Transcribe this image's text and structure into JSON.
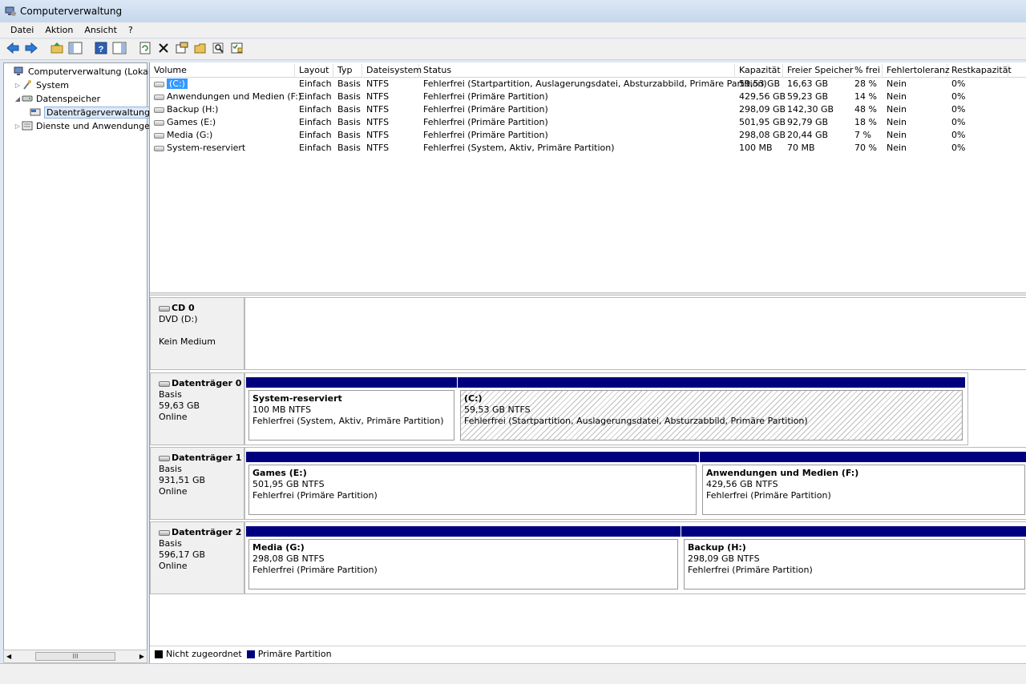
{
  "window": {
    "title": "Computerverwaltung"
  },
  "menu": [
    "Datei",
    "Aktion",
    "Ansicht",
    "?"
  ],
  "toolbar": [
    "back-icon",
    "forward-icon",
    "sep",
    "up-folder-icon",
    "show-hide-tree-icon",
    "sep",
    "help-icon",
    "show-action-pane-icon",
    "sep",
    "refresh-icon",
    "delete-icon",
    "properties-icon",
    "open-icon",
    "search-icon",
    "checklist-icon"
  ],
  "tree": [
    {
      "label": "Computerverwaltung (Lokal)",
      "level": 0,
      "arrow": "",
      "icon": "computer-icon",
      "selected": false
    },
    {
      "label": "System",
      "level": 1,
      "arrow": "▷",
      "icon": "tools-icon",
      "selected": false
    },
    {
      "label": "Datenspeicher",
      "level": 1,
      "arrow": "◢",
      "icon": "storage-icon",
      "selected": false
    },
    {
      "label": "Datenträgerverwaltung",
      "level": 2,
      "arrow": "",
      "icon": "disk-management-icon",
      "selected": true
    },
    {
      "label": "Dienste und Anwendungen",
      "level": 1,
      "arrow": "▷",
      "icon": "services-icon",
      "selected": false
    }
  ],
  "scroll_thumb": "III",
  "columns": [
    "Volume",
    "Layout",
    "Typ",
    "Dateisystem",
    "Status",
    "Kapazität",
    "Freier Speicher",
    "% frei",
    "Fehlertoleranz",
    "Restkapazität"
  ],
  "volumes": [
    {
      "cells": [
        "(C:)",
        "Einfach",
        "Basis",
        "NTFS",
        "Fehlerfrei (Startpartition, Auslagerungsdatei, Absturzabbild, Primäre Partition)",
        "59,53 GB",
        "16,63 GB",
        "28 %",
        "Nein",
        "0%"
      ],
      "selected": true
    },
    {
      "cells": [
        "Anwendungen und Medien (F:)",
        "Einfach",
        "Basis",
        "NTFS",
        "Fehlerfrei (Primäre Partition)",
        "429,56 GB",
        "59,23 GB",
        "14 %",
        "Nein",
        "0%"
      ]
    },
    {
      "cells": [
        "Backup (H:)",
        "Einfach",
        "Basis",
        "NTFS",
        "Fehlerfrei (Primäre Partition)",
        "298,09 GB",
        "142,30 GB",
        "48 %",
        "Nein",
        "0%"
      ]
    },
    {
      "cells": [
        "Games (E:)",
        "Einfach",
        "Basis",
        "NTFS",
        "Fehlerfrei (Primäre Partition)",
        "501,95 GB",
        "92,79 GB",
        "18 %",
        "Nein",
        "0%"
      ]
    },
    {
      "cells": [
        "Media (G:)",
        "Einfach",
        "Basis",
        "NTFS",
        "Fehlerfrei (Primäre Partition)",
        "298,08 GB",
        "20,44 GB",
        "7 %",
        "Nein",
        "0%"
      ]
    },
    {
      "cells": [
        "System-reserviert",
        "Einfach",
        "Basis",
        "NTFS",
        "Fehlerfrei (System, Aktiv, Primäre Partition)",
        "100 MB",
        "70 MB",
        "70 %",
        "Nein",
        "0%"
      ]
    }
  ],
  "disks": [
    {
      "name": "CD 0",
      "lines": [
        "DVD (D:)",
        "",
        "Kein Medium"
      ],
      "partitions": []
    },
    {
      "name": "Datenträger 0",
      "lines": [
        "Basis",
        "59,63 GB",
        "Online"
      ],
      "partitions": [
        {
          "name": "System-reserviert",
          "size": "100 MB NTFS",
          "status": "Fehlerfrei (System, Aktiv, Primäre Partition)",
          "hatched": false
        },
        {
          "name": "(C:)",
          "size": "59,53 GB NTFS",
          "status": "Fehlerfrei (Startpartition, Auslagerungsdatei, Absturzabbild, Primäre Partition)",
          "hatched": true
        }
      ]
    },
    {
      "name": "Datenträger 1",
      "lines": [
        "Basis",
        "931,51 GB",
        "Online"
      ],
      "partitions": [
        {
          "name": "Games  (E:)",
          "size": "501,95 GB NTFS",
          "status": "Fehlerfrei (Primäre Partition)",
          "hatched": false
        },
        {
          "name": "Anwendungen und Medien  (F:)",
          "size": "429,56 GB NTFS",
          "status": "Fehlerfrei (Primäre Partition)",
          "hatched": false
        }
      ]
    },
    {
      "name": "Datenträger 2",
      "lines": [
        "Basis",
        "596,17 GB",
        "Online"
      ],
      "partitions": [
        {
          "name": "Media  (G:)",
          "size": "298,08 GB NTFS",
          "status": "Fehlerfrei (Primäre Partition)",
          "hatched": false
        },
        {
          "name": "Backup  (H:)",
          "size": "298,09 GB NTFS",
          "status": "Fehlerfrei (Primäre Partition)",
          "hatched": false
        }
      ]
    }
  ],
  "legend": [
    {
      "label": "Nicht zugeordnet",
      "color": "#000000"
    },
    {
      "label": "Primäre Partition",
      "color": "#00007f"
    }
  ]
}
